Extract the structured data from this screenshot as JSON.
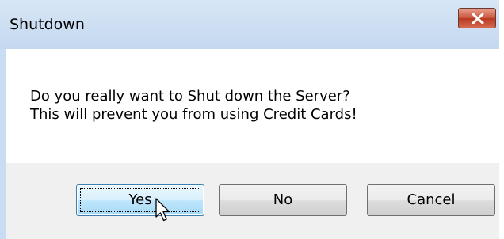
{
  "window": {
    "title": "Shutdown",
    "close_icon": "close-x-icon"
  },
  "message": {
    "line1": "Do you really want to Shut down the Server?",
    "line2": "This will prevent you from using Credit Cards!"
  },
  "buttons": {
    "yes": {
      "label": "Yes",
      "accelerator": "Y",
      "focused": true
    },
    "no": {
      "label": "No",
      "accelerator": "N"
    },
    "cancel": {
      "label": "Cancel"
    }
  },
  "cursor": {
    "icon": "arrow-cursor-icon"
  },
  "colors": {
    "titlebar": "#c9dcf2",
    "close_button": "#c9533a",
    "focused_button_border": "#3c7fb1",
    "button_area": "#f0f0f0"
  }
}
